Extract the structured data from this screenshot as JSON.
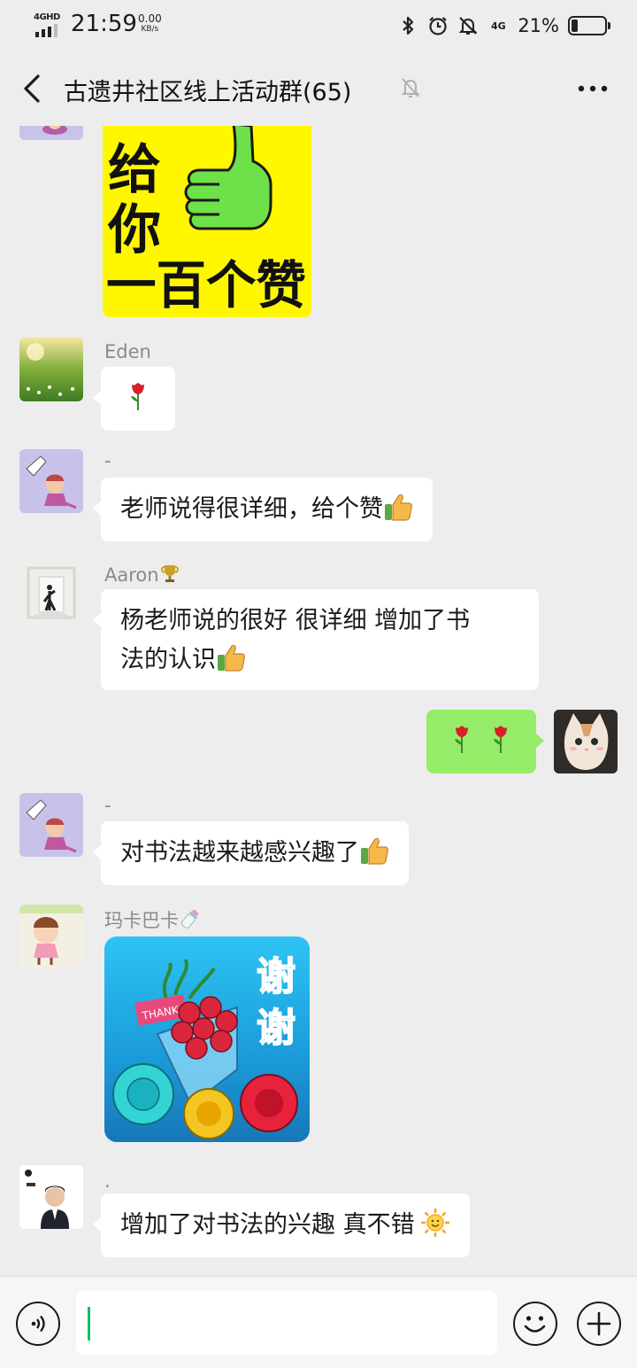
{
  "status_bar": {
    "network": "4GHD",
    "time": "21:59",
    "speed_value": "0.00",
    "speed_unit": "KB/s",
    "network2": "4G",
    "battery_percent": "21%",
    "battery_level": 0.21
  },
  "header": {
    "title": "古遗井社区线上活动群(65)",
    "muted": true
  },
  "stickers": {
    "top_sticker_text": "给你一百个赞",
    "thanks_sticker_text": "谢谢",
    "thanks_tag": "THANK"
  },
  "messages": [
    {
      "sender": "Eden",
      "text": ""
    },
    {
      "sender": "-",
      "text": "老师说得很详细，给个赞"
    },
    {
      "sender": "Aaron",
      "text_line1": "杨老师说的很好 很详细 增加了书",
      "text_line2": "法的认识"
    },
    {
      "sender": "me",
      "text": ""
    },
    {
      "sender": "-",
      "text": "对书法越来越感兴趣了"
    },
    {
      "sender": "玛卡巴卡",
      "text": ""
    },
    {
      "sender": ".",
      "text": "增加了对书法的兴趣 真不错"
    }
  ],
  "input": {
    "placeholder": "",
    "value": ""
  },
  "colors": {
    "chat_background": "#ededed",
    "my_bubble": "#95ec69",
    "their_bubble": "#ffffff",
    "caret": "#07c160"
  }
}
